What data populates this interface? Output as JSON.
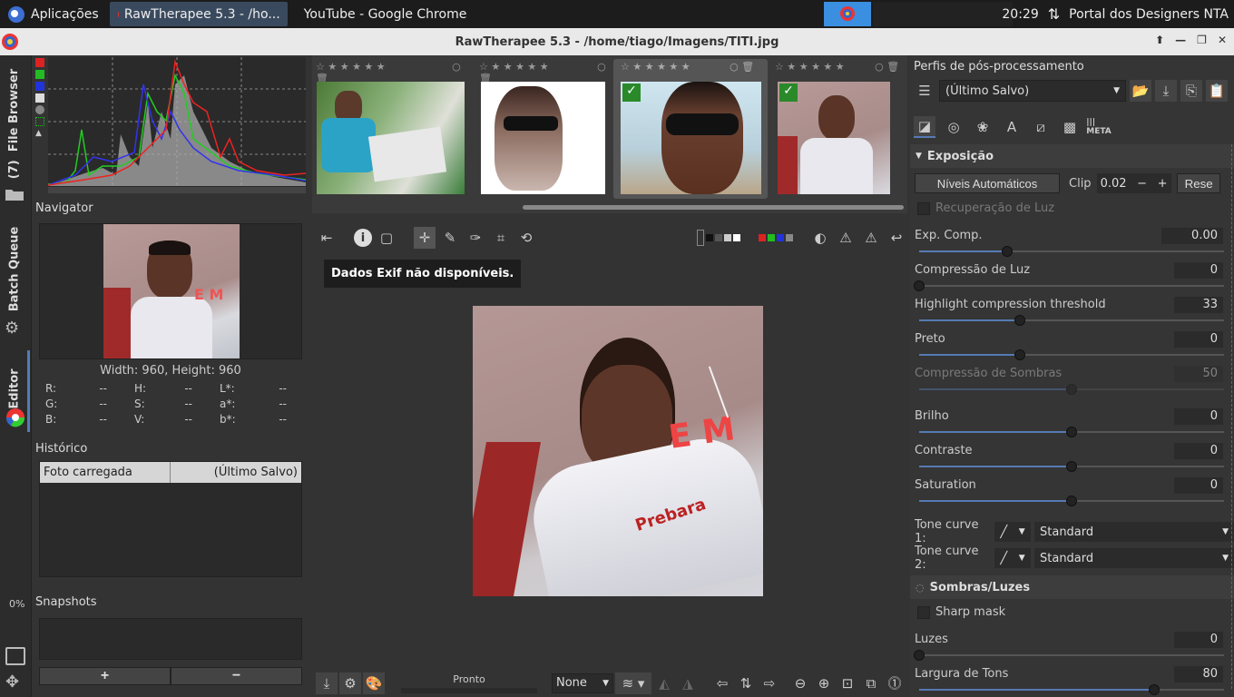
{
  "taskbar": {
    "apps_label": "Aplicações",
    "tasks": [
      {
        "label": "RawTherapee 5.3 - /ho..."
      },
      {
        "label": "YouTube - Google Chrome"
      }
    ],
    "clock": "20:29",
    "portal": "Portal dos Designers NTA"
  },
  "window": {
    "title": "RawTherapee 5.3 - /home/tiago/Imagens/TITI.jpg"
  },
  "left_tabs": {
    "file_browser": "File Browser",
    "file_browser_count": "(7)",
    "batch_queue": "Batch Queue",
    "editor": "Editor",
    "progress": "0%"
  },
  "navigator": {
    "title": "Navigator",
    "size_text": "Width: 960, Height: 960",
    "rows": [
      {
        "l1": "R:",
        "v1": "--",
        "l2": "H:",
        "v2": "--",
        "l3": "L*:",
        "v3": "--"
      },
      {
        "l1": "G:",
        "v1": "--",
        "l2": "S:",
        "v2": "--",
        "l3": "a*:",
        "v3": "--"
      },
      {
        "l1": "B:",
        "v1": "--",
        "l2": "V:",
        "v2": "--",
        "l3": "b*:",
        "v3": "--"
      }
    ]
  },
  "history": {
    "title": "Histórico",
    "item_name": "Foto carregada",
    "item_value": "(Último Salvo)"
  },
  "snapshots": {
    "title": "Snapshots",
    "add": "+",
    "remove": "−"
  },
  "exif": {
    "message": "Dados Exif não disponíveis."
  },
  "status": {
    "ready": "Pronto",
    "color_profile": "None"
  },
  "right": {
    "profiles_title": "Perfis de pós-processamento",
    "profile_selected": "(Último Salvo)",
    "exposure_title": "Exposição",
    "auto_levels": "Níveis Automáticos",
    "clip_label": "Clip",
    "clip_value": "0.02",
    "reset_label": "Rese",
    "highlight_recovery": "Recuperação de Luz",
    "sliders": [
      {
        "label": "Exp. Comp.",
        "value": "0.00",
        "pos": 0.29
      },
      {
        "label": "Compressão de Luz",
        "value": "0",
        "pos": 0.0
      },
      {
        "label": "Highlight compression threshold",
        "value": "33",
        "pos": 0.33
      },
      {
        "label": "Preto",
        "value": "0",
        "pos": 0.33
      },
      {
        "label": "Compressão de Sombras",
        "value": "50",
        "pos": 0.5,
        "disabled": true
      },
      {
        "label": "Brilho",
        "value": "0",
        "pos": 0.5
      },
      {
        "label": "Contraste",
        "value": "0",
        "pos": 0.5
      },
      {
        "label": "Saturation",
        "value": "0",
        "pos": 0.5
      }
    ],
    "tone_curve_1": "Tone curve 1:",
    "tone_curve_2": "Tone curve 2:",
    "tone_curve_1_value": "Standard",
    "tone_curve_2_value": "Standard",
    "shadows_title": "Sombras/Luzes",
    "sharp_mask": "Sharp mask",
    "luzes_label": "Luzes",
    "luzes_value": "0",
    "largura_label": "Largura de Tons",
    "largura_value": "80"
  },
  "colors": {
    "accent": "#557ab3",
    "taskbar": "#1c1c1c",
    "titlebar": "#e9e9e9"
  }
}
